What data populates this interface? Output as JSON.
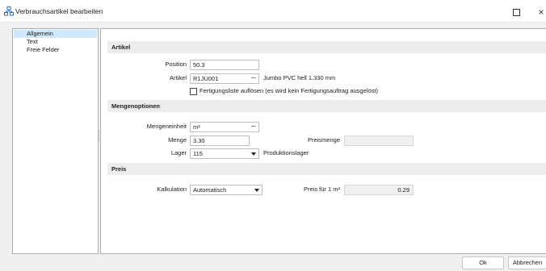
{
  "window": {
    "title": "Verbrauchsartikel bearbeiten",
    "app_icon": "hierarchy-icon",
    "maximize_icon": "maximize-icon",
    "close_icon": "close-icon",
    "close_glyph": "×"
  },
  "nav": {
    "items": [
      {
        "label": "Allgemein",
        "selected": true
      },
      {
        "label": "Text",
        "selected": false
      },
      {
        "label": "Freie Felder",
        "selected": false
      }
    ],
    "selected_color": "#cde8ff"
  },
  "artikel": {
    "header": "Artikel",
    "position_label": "Position",
    "position_value": "50.3",
    "artikel_label": "Artikel",
    "artikel_value": "R1JU001",
    "artikel_picker_glyph": "...",
    "artikel_description": "Jumbo PVC hell 1.330 mm",
    "fertigungsliste_label": "Fertigungsliste auflösen (es wird kein Fertigungsauftrag ausgelöst)",
    "fertigungsliste_checked": false
  },
  "mengen": {
    "header": "Mengenoptionen",
    "mengeneinheit_label": "Mengeneinheit",
    "mengeneinheit_value": "m²",
    "mengeneinheit_picker_glyph": "...",
    "menge_label": "Menge",
    "menge_value": "3.30",
    "preismenge_label": "Preismenge",
    "preismenge_value": "",
    "lager_label": "Lager",
    "lager_value": "115",
    "lager_description": "Produktionslager"
  },
  "preis": {
    "header": "Preis",
    "kalkulation_label": "Kalkulation",
    "kalkulation_value": "Automatisch",
    "preis_label": "Preis für 1 m²",
    "preis_value": "0.29"
  },
  "buttons": {
    "ok": "Ok",
    "cancel": "Abbrechen"
  }
}
